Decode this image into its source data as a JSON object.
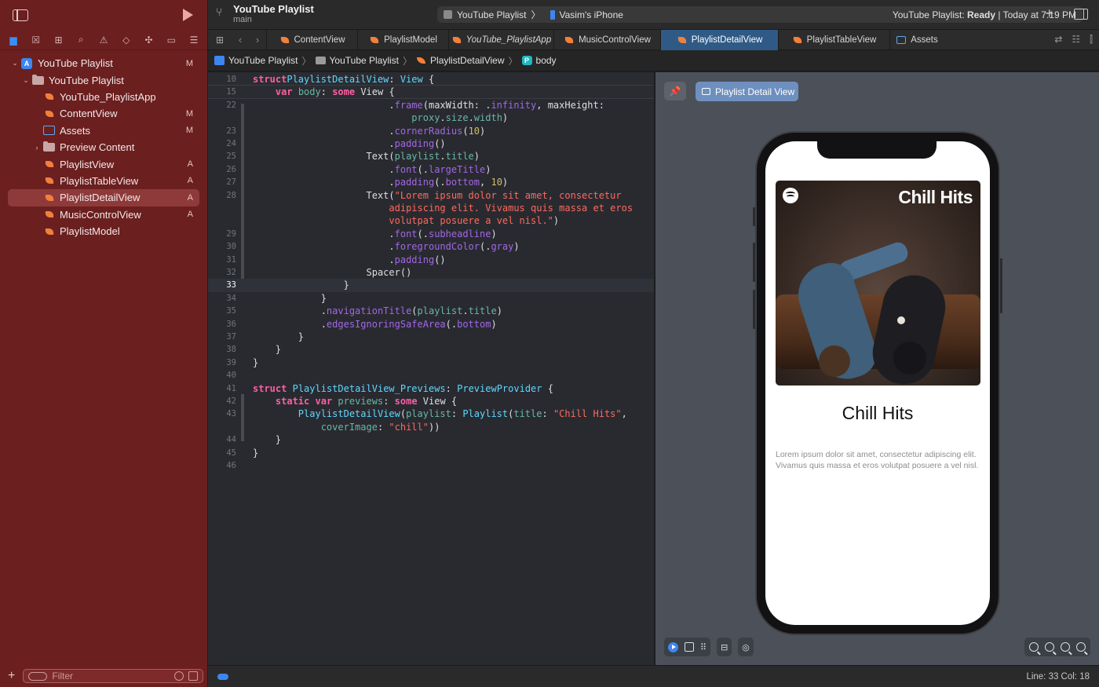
{
  "sidebar": {
    "filter_placeholder": "Filter",
    "items": [
      {
        "label": "YouTube Playlist",
        "badge": "M",
        "kind": "project",
        "level": 0,
        "expanded": true
      },
      {
        "label": "YouTube Playlist",
        "badge": "",
        "kind": "folder",
        "level": 1,
        "expanded": true
      },
      {
        "label": "YouTube_PlaylistApp",
        "badge": "",
        "kind": "swift",
        "level": 2
      },
      {
        "label": "ContentView",
        "badge": "M",
        "kind": "swift",
        "level": 2
      },
      {
        "label": "Assets",
        "badge": "M",
        "kind": "assets",
        "level": 2
      },
      {
        "label": "Preview Content",
        "badge": "",
        "kind": "folder",
        "level": 2,
        "expanded": false
      },
      {
        "label": "PlaylistView",
        "badge": "A",
        "kind": "swift",
        "level": 2
      },
      {
        "label": "PlaylistTableView",
        "badge": "A",
        "kind": "swift",
        "level": 2
      },
      {
        "label": "PlaylistDetailView",
        "badge": "A",
        "kind": "swift",
        "level": 2,
        "selected": true
      },
      {
        "label": "MusicControlView",
        "badge": "A",
        "kind": "swift",
        "level": 2
      },
      {
        "label": "PlaylistModel",
        "badge": "",
        "kind": "swift",
        "level": 2
      }
    ]
  },
  "toolbar": {
    "project": "YouTube Playlist",
    "branch": "main",
    "scheme": "YouTube Playlist",
    "device": "Vasim's iPhone",
    "status_prefix": "YouTube Playlist: ",
    "status_state": "Ready",
    "status_suffix": " | Today at 7:19 PM"
  },
  "tabs": [
    {
      "label": "ContentView",
      "italic": false,
      "active": false,
      "icon": "swift-icon"
    },
    {
      "label": "PlaylistModel",
      "italic": false,
      "active": false,
      "icon": "swift-icon"
    },
    {
      "label": "YouTube_PlaylistApp",
      "italic": true,
      "active": false,
      "icon": "swift-icon"
    },
    {
      "label": "MusicControlView",
      "italic": false,
      "active": false,
      "icon": "swift-icon"
    },
    {
      "label": "PlaylistDetailView",
      "italic": false,
      "active": true,
      "icon": "swift-icon"
    },
    {
      "label": "PlaylistTableView",
      "italic": false,
      "active": false,
      "icon": "swift-icon"
    },
    {
      "label": "Assets",
      "italic": false,
      "active": false,
      "icon": "assets-icon"
    }
  ],
  "breadcrumb": [
    "YouTube Playlist",
    "YouTube Playlist",
    "PlaylistDetailView",
    "body"
  ],
  "breadcrumb_symbol_badge": "P",
  "editor": {
    "lines": [
      {
        "n": "10",
        "sticky": true,
        "t": [
          [
            "kw",
            "struct"
          ],
          [
            "",
            ""
          ],
          [
            " ",
            ""
          ],
          [
            "ty",
            "PlaylistDetailView"
          ],
          [
            "",
            ": "
          ],
          [
            "ty",
            "View"
          ],
          [
            "",
            " {"
          ]
        ]
      },
      {
        "n": "15",
        "sticky": true,
        "t": [
          [
            "",
            "    "
          ],
          [
            "kw",
            "var"
          ],
          [
            "",
            " "
          ],
          [
            "pr",
            "body"
          ],
          [
            "",
            ": "
          ],
          [
            "kw",
            "some"
          ],
          [
            "",
            " View {"
          ]
        ]
      },
      {
        "n": "22",
        "t": [
          [
            "",
            "                        ."
          ],
          [
            "fn",
            "frame"
          ],
          [
            "",
            "(maxWidth: ."
          ],
          [
            "fn",
            "infinity"
          ],
          [
            "",
            ", maxHeight:"
          ]
        ]
      },
      {
        "n": "",
        "t": [
          [
            "",
            "                            "
          ],
          [
            "pr",
            "proxy"
          ],
          [
            "",
            "."
          ],
          [
            "pr",
            "size"
          ],
          [
            "",
            "."
          ],
          [
            "pr",
            "width"
          ],
          [
            "",
            ")"
          ]
        ]
      },
      {
        "n": "23",
        "t": [
          [
            "",
            "                        ."
          ],
          [
            "fn",
            "cornerRadius"
          ],
          [
            "",
            "("
          ],
          [
            "nm",
            "10"
          ],
          [
            "",
            ")"
          ]
        ]
      },
      {
        "n": "24",
        "t": [
          [
            "",
            "                        ."
          ],
          [
            "fn",
            "padding"
          ],
          [
            "",
            "()"
          ]
        ]
      },
      {
        "n": "25",
        "t": [
          [
            "",
            "                    Text("
          ],
          [
            "pr",
            "playlist"
          ],
          [
            "",
            "."
          ],
          [
            "pr",
            "title"
          ],
          [
            "",
            ")"
          ]
        ]
      },
      {
        "n": "26",
        "t": [
          [
            "",
            "                        ."
          ],
          [
            "fn",
            "font"
          ],
          [
            "",
            "(."
          ],
          [
            "fn",
            "largeTitle"
          ],
          [
            "",
            ")"
          ]
        ]
      },
      {
        "n": "27",
        "t": [
          [
            "",
            "                        ."
          ],
          [
            "fn",
            "padding"
          ],
          [
            "",
            "(."
          ],
          [
            "fn",
            "bottom"
          ],
          [
            "",
            ", "
          ],
          [
            "nm",
            "10"
          ],
          [
            "",
            ")"
          ]
        ]
      },
      {
        "n": "28",
        "t": [
          [
            "",
            "                    Text("
          ],
          [
            "st",
            "\"Lorem ipsum dolor sit amet, consectetur"
          ]
        ]
      },
      {
        "n": "",
        "t": [
          [
            "",
            "                        "
          ],
          [
            "st",
            "adipiscing elit. Vivamus quis massa et eros"
          ]
        ]
      },
      {
        "n": "",
        "t": [
          [
            "",
            "                        "
          ],
          [
            "st",
            "volutpat posuere a vel nisl.\""
          ],
          [
            "",
            ")"
          ]
        ]
      },
      {
        "n": "29",
        "t": [
          [
            "",
            "                        ."
          ],
          [
            "fn",
            "font"
          ],
          [
            "",
            "(."
          ],
          [
            "fn",
            "subheadline"
          ],
          [
            "",
            ")"
          ]
        ]
      },
      {
        "n": "30",
        "t": [
          [
            "",
            "                        ."
          ],
          [
            "fn",
            "foregroundColor"
          ],
          [
            "",
            "(."
          ],
          [
            "fn",
            "gray"
          ],
          [
            "",
            ")"
          ]
        ]
      },
      {
        "n": "31",
        "t": [
          [
            "",
            "                        ."
          ],
          [
            "fn",
            "padding"
          ],
          [
            "",
            "()"
          ]
        ]
      },
      {
        "n": "32",
        "t": [
          [
            "",
            "                    Spacer()"
          ]
        ]
      },
      {
        "n": "33",
        "cur": true,
        "t": [
          [
            "",
            "                }"
          ]
        ]
      },
      {
        "n": "34",
        "t": [
          [
            "",
            "            }"
          ]
        ]
      },
      {
        "n": "35",
        "t": [
          [
            "",
            "            ."
          ],
          [
            "fn",
            "navigationTitle"
          ],
          [
            "",
            "("
          ],
          [
            "pr",
            "playlist"
          ],
          [
            "",
            "."
          ],
          [
            "pr",
            "title"
          ],
          [
            "",
            ")"
          ]
        ]
      },
      {
        "n": "36",
        "t": [
          [
            "",
            "            ."
          ],
          [
            "fn",
            "edgesIgnoringSafeArea"
          ],
          [
            "",
            "(."
          ],
          [
            "fn",
            "bottom"
          ],
          [
            "",
            ")"
          ]
        ]
      },
      {
        "n": "37",
        "t": [
          [
            "",
            "        }"
          ]
        ]
      },
      {
        "n": "38",
        "t": [
          [
            "",
            "    }"
          ]
        ]
      },
      {
        "n": "39",
        "t": [
          [
            "",
            "}"
          ]
        ]
      },
      {
        "n": "40",
        "t": [
          [
            "",
            ""
          ]
        ]
      },
      {
        "n": "41",
        "t": [
          [
            "kw",
            "struct"
          ],
          [
            "",
            " "
          ],
          [
            "ty",
            "PlaylistDetailView_Previews"
          ],
          [
            "",
            ": "
          ],
          [
            "ty",
            "PreviewProvider"
          ],
          [
            "",
            " {"
          ]
        ]
      },
      {
        "n": "42",
        "t": [
          [
            "",
            "    "
          ],
          [
            "kw",
            "static"
          ],
          [
            "",
            " "
          ],
          [
            "kw",
            "var"
          ],
          [
            "",
            " "
          ],
          [
            "pr",
            "previews"
          ],
          [
            "",
            ": "
          ],
          [
            "kw",
            "some"
          ],
          [
            "",
            " View {"
          ]
        ]
      },
      {
        "n": "43",
        "t": [
          [
            "",
            "        "
          ],
          [
            "ty",
            "PlaylistDetailView"
          ],
          [
            "",
            "("
          ],
          [
            "pr",
            "playlist"
          ],
          [
            "",
            ": "
          ],
          [
            "ty",
            "Playlist"
          ],
          [
            "",
            "("
          ],
          [
            "pr",
            "title"
          ],
          [
            "",
            ": "
          ],
          [
            "st",
            "\"Chill Hits\""
          ],
          [
            "",
            ","
          ]
        ]
      },
      {
        "n": "",
        "t": [
          [
            "",
            "            "
          ],
          [
            "pr",
            "coverImage"
          ],
          [
            "",
            ": "
          ],
          [
            "st",
            "\"chill\""
          ],
          [
            "",
            "))"
          ]
        ]
      },
      {
        "n": "44",
        "t": [
          [
            "",
            "    }"
          ]
        ]
      },
      {
        "n": "45",
        "t": [
          [
            "",
            "}"
          ]
        ]
      },
      {
        "n": "46",
        "t": [
          [
            "",
            ""
          ]
        ]
      }
    ]
  },
  "preview": {
    "label": "Playlist Detail View",
    "cover_title": "Chill Hits",
    "playlist_title": "Chill Hits",
    "description": "Lorem ipsum dolor sit amet, consectetur adipiscing elit. Vivamus quis massa et eros volutpat posuere a vel nisl."
  },
  "statusbar": {
    "position": "Line: 33  Col: 18"
  },
  "colors": {
    "sidebar_bg": "#6b1f1f",
    "accent": "#3d86f0",
    "active_tab": "#2f5a86"
  }
}
